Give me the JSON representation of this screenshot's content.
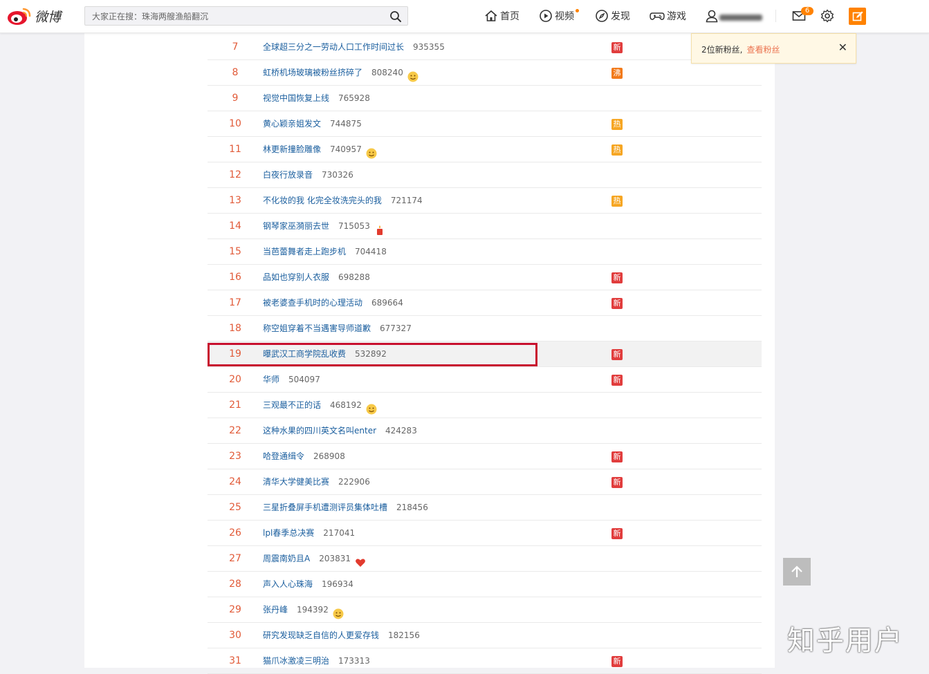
{
  "header": {
    "logo_text": "微博",
    "search_placeholder": "大家正在搜：珠海两艘渔船翻沉",
    "nav": {
      "home": "首页",
      "video": "视频",
      "discover": "发现",
      "game": "游戏"
    },
    "message_count": "6"
  },
  "notification": {
    "text": "2位新粉丝,",
    "link": "查看粉丝",
    "close": "✕"
  },
  "hot_search": [
    {
      "rank": "7",
      "title": "全球超三分之一劳动人口工作时间过长",
      "count": "935355",
      "tag": "新",
      "tag_type": "new"
    },
    {
      "rank": "8",
      "title": "虹桥机场玻璃被粉丝挤碎了",
      "count": "808240",
      "emoji": "laugh-cry",
      "tag": "沸",
      "tag_type": "boil"
    },
    {
      "rank": "9",
      "title": "视觉中国恢复上线",
      "count": "765928"
    },
    {
      "rank": "10",
      "title": "黄心颖亲姐发文",
      "count": "744875",
      "tag": "热",
      "tag_type": "hot"
    },
    {
      "rank": "11",
      "title": "林更新撞脸雕像",
      "count": "740957",
      "emoji": "laugh",
      "tag": "热",
      "tag_type": "hot"
    },
    {
      "rank": "12",
      "title": "白夜行放录音",
      "count": "730326"
    },
    {
      "rank": "13",
      "title": "不化妆的我 化完全妆洗完头的我",
      "count": "721174",
      "tag": "热",
      "tag_type": "hot"
    },
    {
      "rank": "14",
      "title": "钢琴家巫漪丽去世",
      "count": "715053",
      "emoji": "candle"
    },
    {
      "rank": "15",
      "title": "当芭蕾舞者走上跑步机",
      "count": "704418"
    },
    {
      "rank": "16",
      "title": "品如也穿别人衣服",
      "count": "698288",
      "tag": "新",
      "tag_type": "new"
    },
    {
      "rank": "17",
      "title": "被老婆查手机时的心理活动",
      "count": "689664",
      "tag": "新",
      "tag_type": "new"
    },
    {
      "rank": "18",
      "title": "称空姐穿着不当遇害导师道歉",
      "count": "677327"
    },
    {
      "rank": "19",
      "title": "曝武汉工商学院乱收费",
      "count": "532892",
      "tag": "新",
      "tag_type": "new"
    },
    {
      "rank": "20",
      "title": "华师",
      "count": "504097",
      "tag": "新",
      "tag_type": "new"
    },
    {
      "rank": "21",
      "title": "三观最不正的话",
      "count": "468192",
      "emoji": "shocked"
    },
    {
      "rank": "22",
      "title": "这种水果的四川英文名叫enter",
      "count": "424283"
    },
    {
      "rank": "23",
      "title": "哈登通缉令",
      "count": "268908",
      "tag": "新",
      "tag_type": "new"
    },
    {
      "rank": "24",
      "title": "清华大学健美比赛",
      "count": "222906",
      "tag": "新",
      "tag_type": "new"
    },
    {
      "rank": "25",
      "title": "三星折叠屏手机遭测评员集体吐槽",
      "count": "218456"
    },
    {
      "rank": "26",
      "title": "lpl春季总决赛",
      "count": "217041",
      "tag": "新",
      "tag_type": "new"
    },
    {
      "rank": "27",
      "title": "周震南奶且A",
      "count": "203831",
      "emoji": "heart"
    },
    {
      "rank": "28",
      "title": "声入人心珠海",
      "count": "196934"
    },
    {
      "rank": "29",
      "title": "张丹峰",
      "count": "194392",
      "emoji": "thinking"
    },
    {
      "rank": "30",
      "title": "研究发现缺乏自信的人更爱存钱",
      "count": "182156"
    },
    {
      "rank": "31",
      "title": "猫爪冰激凌三明治",
      "count": "173313",
      "tag": "新",
      "tag_type": "new"
    }
  ],
  "watermark": "知乎用户",
  "colors": {
    "rank": "#e15a38",
    "link": "#1a5e9e",
    "accent": "#ff8200",
    "highlight_box": "#c8102e"
  }
}
